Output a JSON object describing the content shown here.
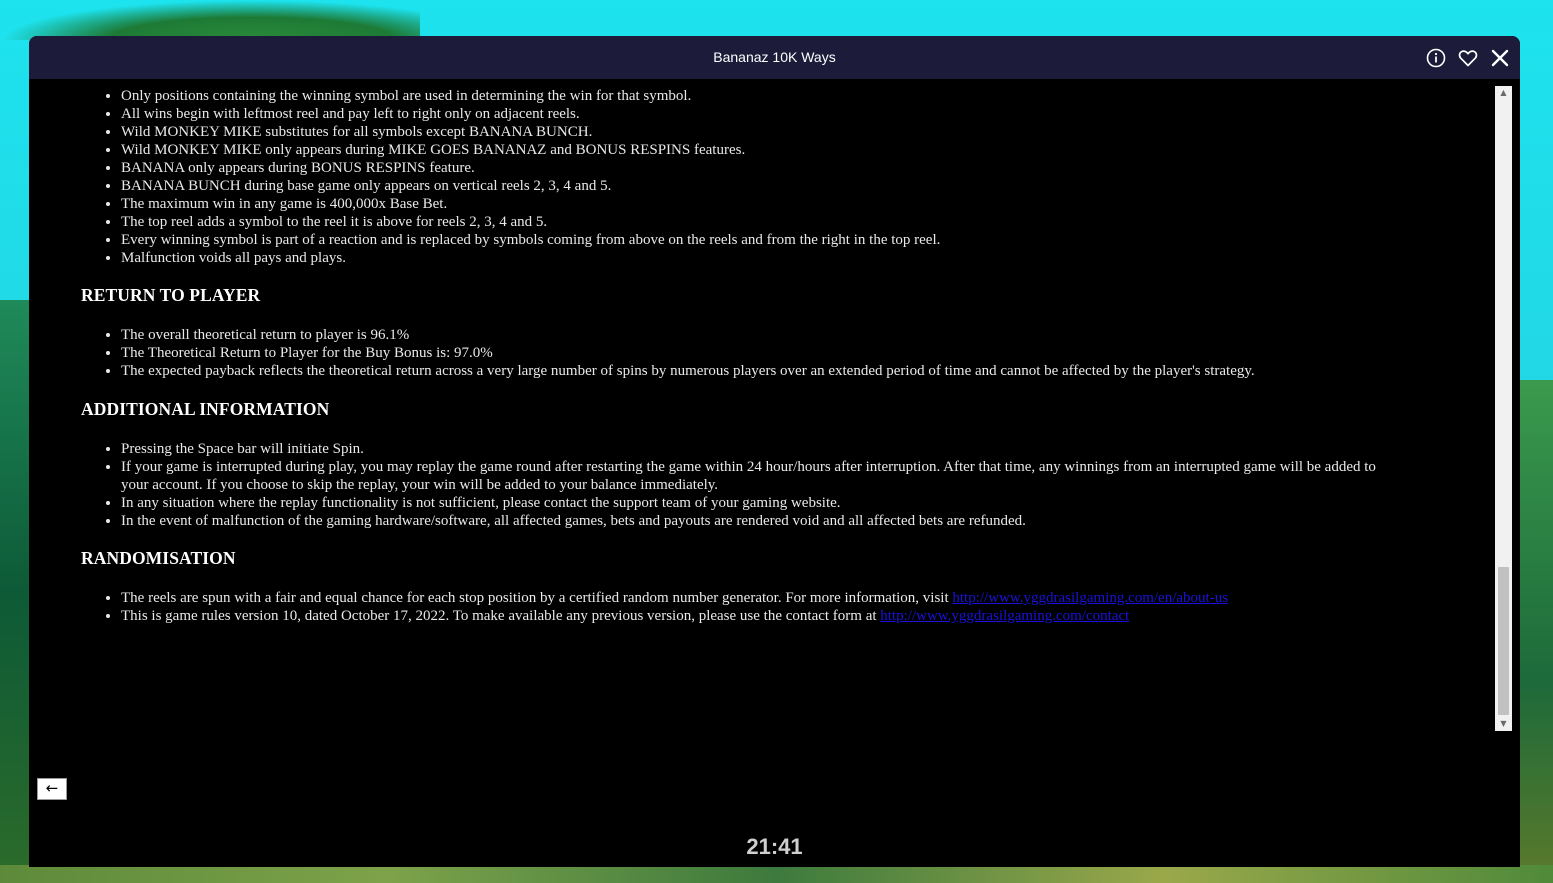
{
  "window": {
    "title": "Bananaz 10K Ways"
  },
  "toolbar": {
    "info_icon": "info-icon",
    "favorite_icon": "heart-icon",
    "close_icon": "close-icon"
  },
  "rules": {
    "general_items": [
      "Only positions containing the winning symbol are used in determining the win for that symbol.",
      "All wins begin with leftmost reel and pay left to right only on adjacent reels.",
      "Wild MONKEY MIKE substitutes for all symbols except BANANA BUNCH.",
      "Wild MONKEY MIKE only appears during MIKE GOES BANANAZ and BONUS RESPINS features.",
      "BANANA only appears during BONUS RESPINS feature.",
      "BANANA BUNCH during base game only appears on vertical reels 2, 3, 4 and 5.",
      "The maximum win in any game is 400,000x Base Bet.",
      "The top reel adds a symbol to the reel it is above for reels 2, 3, 4 and 5.",
      "Every winning symbol is part of a reaction and is replaced by symbols coming from above on the reels and from the right in the top reel.",
      "Malfunction voids all pays and plays."
    ],
    "rtp_heading": "RETURN TO PLAYER",
    "rtp_items": [
      "The overall theoretical return to player is 96.1%",
      "The Theoretical Return to Player for the Buy Bonus is: 97.0%",
      "The expected payback reflects the theoretical return across a very large number of spins by numerous players over an extended period of time and cannot be affected by the player's strategy."
    ],
    "additional_heading": "ADDITIONAL INFORMATION",
    "additional_items": [
      "Pressing the Space bar will initiate Spin.",
      "If your game is interrupted during play, you may replay the game round after restarting the game within 24 hour/hours after interruption. After that time, any winnings from an interrupted game will be added to your account. If you choose to skip the replay, your win will be added to your balance immediately.",
      "In any situation where the replay functionality is not sufficient, please contact the support team of your gaming website.",
      "In the event of malfunction of the gaming hardware/software, all affected games, bets and payouts are rendered void and all affected bets are refunded."
    ],
    "random_heading": "RANDOMISATION",
    "random_items": [
      {
        "text": "The reels are spun with a fair and equal chance for each stop position by a certified random number generator. For more information, visit ",
        "link": "http://www.yggdrasilgaming.com/en/about-us"
      },
      {
        "text": "This is game rules version 10, dated October 17, 2022. To make available any previous version, please use the contact form at ",
        "link": "http://www.yggdrasilgaming.com/contact"
      }
    ]
  },
  "back_button": {
    "label": "←"
  },
  "clock": {
    "time": "21:41"
  }
}
